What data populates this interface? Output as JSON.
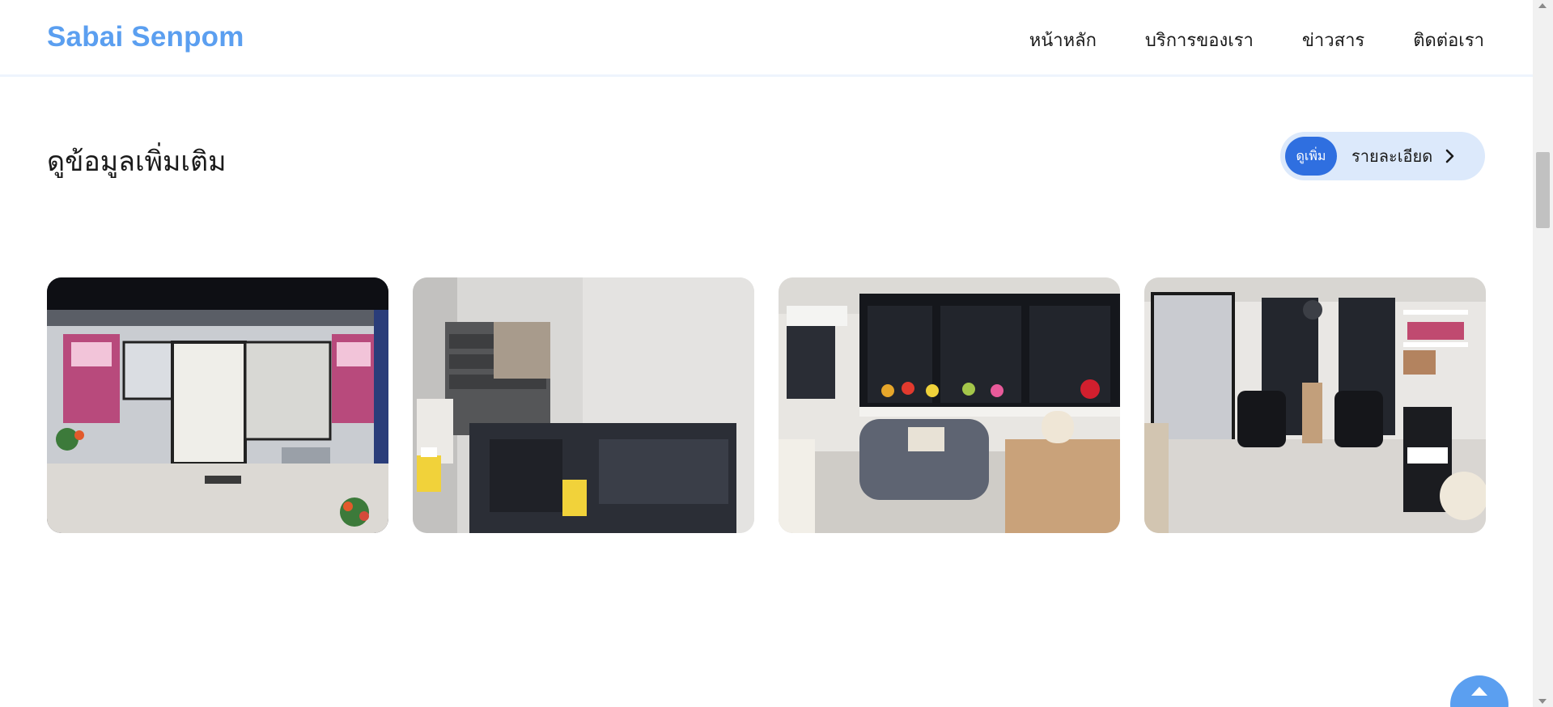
{
  "header": {
    "brand": "Sabai Senpom",
    "nav": [
      "หน้าหลัก",
      "บริการของเรา",
      "ข่าวสาร",
      "ติดต่อเรา"
    ]
  },
  "section": {
    "title": "ดูข้อมูลเพิ่มเติม",
    "more_button": {
      "pill_label": "ดูเพิ่ม",
      "label": "รายละเอียด",
      "icon": "chevron-right-icon"
    }
  },
  "gallery": [
    {
      "name": "salon-storefront-photo"
    },
    {
      "name": "hair-wash-station-photo"
    },
    {
      "name": "waiting-lounge-photo"
    },
    {
      "name": "styling-chairs-photo"
    }
  ],
  "back_to_top": {
    "icon": "arrow-up-icon"
  },
  "colors": {
    "brand": "#5b9ff0",
    "accent": "#2f6fe0",
    "button_bg": "#dce9fb",
    "text": "#1a1a1a"
  }
}
